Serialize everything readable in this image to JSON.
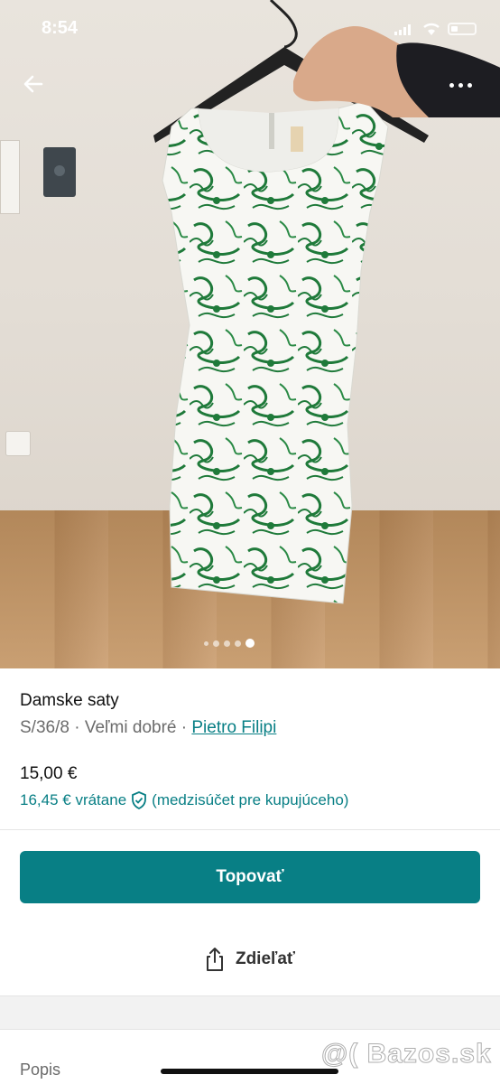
{
  "status_bar": {
    "time": "8:54"
  },
  "gallery": {
    "image_count": 5,
    "active_index": 4
  },
  "listing": {
    "title": "Damske saty",
    "size": "S/36/8",
    "separator": "·",
    "condition": "Veľmi dobré",
    "brand": "Pietro Filipi",
    "price": "15,00 €",
    "price_incl_amount": "16,45 € vrátane",
    "price_incl_note": "(medzisúčet pre kupujúceho)"
  },
  "actions": {
    "bump_label": "Topovať",
    "share_label": "Zdieľať"
  },
  "sections": {
    "description_label": "Popis"
  },
  "watermark": "@( Bazos.sk",
  "colors": {
    "accent": "#087f85",
    "dress_green": "#1f7a3a"
  },
  "icons": [
    "back-arrow-icon",
    "more-icon",
    "shield-check-icon",
    "share-icon"
  ]
}
